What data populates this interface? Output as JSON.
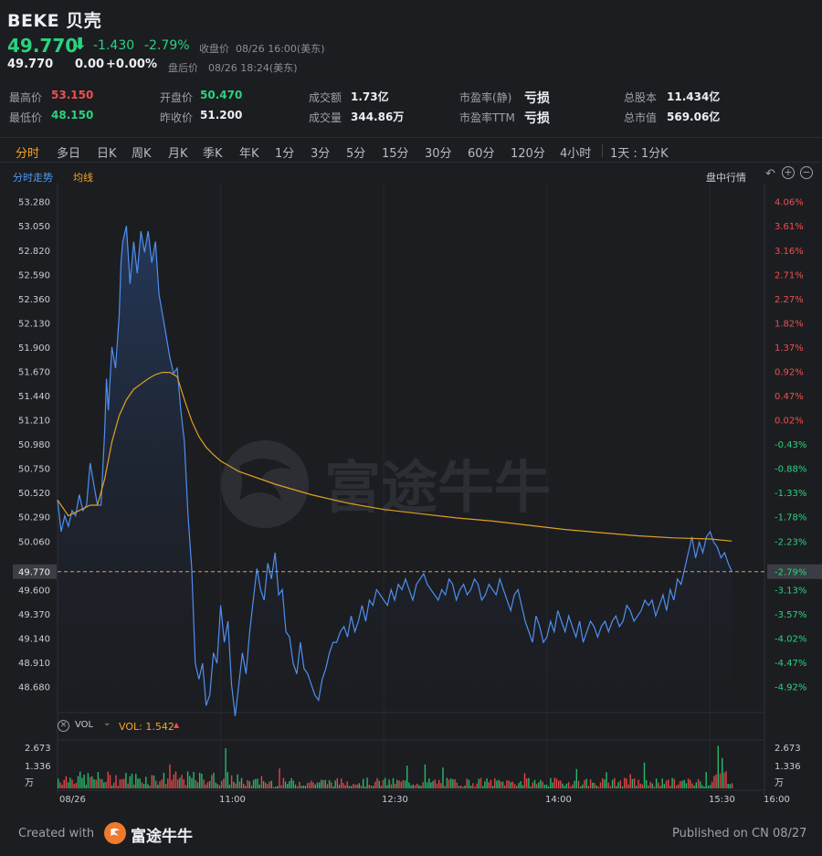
{
  "header": {
    "symbol_name": "BEKE 贝壳",
    "price": "49.770",
    "change": "-1.430",
    "change_pct": "-2.79%",
    "close_label": "收盘价",
    "close_time": "08/26 16:00(美东)",
    "after_price": "49.770",
    "after_change": "0.00",
    "after_pct": "+0.00%",
    "after_label": "盘后价",
    "after_time": "08/26 18:24(美东)"
  },
  "stats": [
    {
      "label": "最高价",
      "value": "53.150",
      "color": "#ee4f4f"
    },
    {
      "label": "开盘价",
      "value": "50.470",
      "color": "#2ad37e"
    },
    {
      "label": "成交额",
      "value": "1.73亿",
      "color": "#eceff3"
    },
    {
      "label": "市盈率(静)",
      "value": "亏损",
      "color": "#eceff3"
    },
    {
      "label": "总股本",
      "value": "11.434亿",
      "color": "#eceff3"
    },
    {
      "label": "最低价",
      "value": "48.150",
      "color": "#2ad37e"
    },
    {
      "label": "昨收价",
      "value": "51.200",
      "color": "#eceff3"
    },
    {
      "label": "成交量",
      "value": "344.86万",
      "color": "#eceff3"
    },
    {
      "label": "市盈率TTM",
      "value": "亏损",
      "color": "#eceff3"
    },
    {
      "label": "总市值",
      "value": "569.06亿",
      "color": "#eceff3"
    }
  ],
  "tabs": [
    "分时",
    "多日",
    "日K",
    "周K",
    "月K",
    "季K",
    "年K",
    "1分",
    "3分",
    "5分",
    "15分",
    "30分",
    "60分",
    "120分",
    "4小时",
    "1天 : 1分K"
  ],
  "active_tab": "分时",
  "chart_header": {
    "left_label": "分时走势",
    "avg_label": "均线",
    "right_label": "盘中行情"
  },
  "volume": {
    "vol_label": "VOL",
    "vol_value": "VOL: 1.542",
    "y_ticks": [
      "2.673",
      "1.336",
      "万"
    ]
  },
  "watermark": "富途牛牛",
  "footer": {
    "created_with": "Created with",
    "brand": "富途牛牛",
    "published": "Published on CN 08/27"
  },
  "chart_data": {
    "type": "line",
    "title": "",
    "prev_close": 51.2,
    "last_price": 49.77,
    "y_ticks": [
      53.28,
      53.05,
      52.82,
      52.59,
      52.36,
      52.13,
      51.9,
      51.67,
      51.44,
      51.21,
      50.98,
      50.75,
      50.52,
      50.29,
      50.06,
      49.77,
      49.6,
      49.37,
      49.14,
      48.91,
      48.68
    ],
    "y_tick_labels": [
      "53.280",
      "53.050",
      "52.820",
      "52.590",
      "52.360",
      "52.130",
      "51.900",
      "51.670",
      "51.440",
      "51.210",
      "50.980",
      "50.750",
      "50.520",
      "50.290",
      "50.060",
      "49.770",
      "49.600",
      "49.370",
      "49.140",
      "48.910",
      "48.680"
    ],
    "pct_labels": [
      "4.06%",
      "3.61%",
      "3.16%",
      "2.71%",
      "2.27%",
      "1.82%",
      "1.37%",
      "0.92%",
      "0.47%",
      "0.02%",
      "-0.43%",
      "-0.88%",
      "-1.33%",
      "-1.78%",
      "-2.23%",
      "-2.79%",
      "-3.13%",
      "-3.57%",
      "-4.02%",
      "-4.47%",
      "-4.92%"
    ],
    "x_labels": [
      "08/26",
      "11:00",
      "12:30",
      "14:00",
      "15:30",
      "16:00"
    ],
    "x_label_minutes": [
      0,
      90,
      180,
      270,
      360,
      390
    ],
    "price_points": [
      [
        0,
        50.45
      ],
      [
        2,
        50.15
      ],
      [
        4,
        50.3
      ],
      [
        6,
        50.2
      ],
      [
        8,
        50.35
      ],
      [
        10,
        50.3
      ],
      [
        12,
        50.5
      ],
      [
        14,
        50.35
      ],
      [
        16,
        50.4
      ],
      [
        18,
        50.8
      ],
      [
        20,
        50.6
      ],
      [
        22,
        50.4
      ],
      [
        24,
        50.4
      ],
      [
        26,
        51.1
      ],
      [
        27,
        51.6
      ],
      [
        28,
        51.3
      ],
      [
        30,
        51.9
      ],
      [
        32,
        51.7
      ],
      [
        34,
        52.2
      ],
      [
        35,
        52.7
      ],
      [
        36,
        52.9
      ],
      [
        38,
        53.05
      ],
      [
        40,
        52.5
      ],
      [
        42,
        52.9
      ],
      [
        44,
        52.6
      ],
      [
        46,
        53.0
      ],
      [
        48,
        52.8
      ],
      [
        50,
        53.0
      ],
      [
        52,
        52.7
      ],
      [
        54,
        52.9
      ],
      [
        56,
        52.4
      ],
      [
        58,
        52.2
      ],
      [
        60,
        52.0
      ],
      [
        62,
        51.8
      ],
      [
        64,
        51.65
      ],
      [
        66,
        51.7
      ],
      [
        68,
        51.3
      ],
      [
        70,
        51.0
      ],
      [
        72,
        50.3
      ],
      [
        74,
        49.8
      ],
      [
        76,
        48.9
      ],
      [
        78,
        48.75
      ],
      [
        80,
        48.9
      ],
      [
        82,
        48.5
      ],
      [
        84,
        48.6
      ],
      [
        86,
        49.0
      ],
      [
        88,
        48.9
      ],
      [
        90,
        49.45
      ],
      [
        92,
        49.1
      ],
      [
        94,
        49.3
      ],
      [
        96,
        48.7
      ],
      [
        98,
        48.4
      ],
      [
        100,
        48.7
      ],
      [
        102,
        49.0
      ],
      [
        104,
        48.8
      ],
      [
        106,
        49.2
      ],
      [
        108,
        49.5
      ],
      [
        110,
        49.8
      ],
      [
        112,
        49.6
      ],
      [
        114,
        49.5
      ],
      [
        116,
        49.85
      ],
      [
        118,
        49.7
      ],
      [
        120,
        49.95
      ],
      [
        122,
        49.55
      ],
      [
        124,
        49.6
      ],
      [
        126,
        49.2
      ],
      [
        128,
        49.15
      ],
      [
        130,
        48.9
      ],
      [
        132,
        48.8
      ],
      [
        134,
        49.1
      ],
      [
        136,
        48.85
      ],
      [
        138,
        48.8
      ],
      [
        140,
        48.7
      ],
      [
        142,
        48.6
      ],
      [
        144,
        48.55
      ],
      [
        146,
        48.75
      ],
      [
        148,
        48.85
      ],
      [
        150,
        49.0
      ],
      [
        152,
        49.1
      ],
      [
        154,
        49.1
      ],
      [
        156,
        49.2
      ],
      [
        158,
        49.25
      ],
      [
        160,
        49.15
      ],
      [
        162,
        49.35
      ],
      [
        164,
        49.2
      ],
      [
        166,
        49.3
      ],
      [
        168,
        49.45
      ],
      [
        170,
        49.3
      ],
      [
        172,
        49.5
      ],
      [
        174,
        49.45
      ],
      [
        176,
        49.6
      ],
      [
        178,
        49.55
      ],
      [
        180,
        49.5
      ],
      [
        182,
        49.45
      ],
      [
        184,
        49.6
      ],
      [
        186,
        49.5
      ],
      [
        188,
        49.65
      ],
      [
        190,
        49.6
      ],
      [
        192,
        49.7
      ],
      [
        194,
        49.6
      ],
      [
        196,
        49.5
      ],
      [
        198,
        49.65
      ],
      [
        200,
        49.7
      ],
      [
        202,
        49.75
      ],
      [
        204,
        49.65
      ],
      [
        206,
        49.6
      ],
      [
        208,
        49.55
      ],
      [
        210,
        49.5
      ],
      [
        212,
        49.6
      ],
      [
        214,
        49.55
      ],
      [
        216,
        49.7
      ],
      [
        218,
        49.65
      ],
      [
        220,
        49.5
      ],
      [
        222,
        49.6
      ],
      [
        224,
        49.65
      ],
      [
        226,
        49.55
      ],
      [
        228,
        49.6
      ],
      [
        230,
        49.7
      ],
      [
        232,
        49.65
      ],
      [
        234,
        49.5
      ],
      [
        236,
        49.55
      ],
      [
        238,
        49.65
      ],
      [
        240,
        49.6
      ],
      [
        242,
        49.55
      ],
      [
        244,
        49.7
      ],
      [
        246,
        49.6
      ],
      [
        248,
        49.5
      ],
      [
        250,
        49.4
      ],
      [
        252,
        49.55
      ],
      [
        254,
        49.6
      ],
      [
        256,
        49.45
      ],
      [
        258,
        49.3
      ],
      [
        260,
        49.2
      ],
      [
        262,
        49.1
      ],
      [
        264,
        49.35
      ],
      [
        266,
        49.25
      ],
      [
        268,
        49.1
      ],
      [
        270,
        49.15
      ],
      [
        272,
        49.3
      ],
      [
        274,
        49.2
      ],
      [
        276,
        49.4
      ],
      [
        278,
        49.3
      ],
      [
        280,
        49.2
      ],
      [
        282,
        49.35
      ],
      [
        284,
        49.25
      ],
      [
        286,
        49.15
      ],
      [
        288,
        49.3
      ],
      [
        290,
        49.1
      ],
      [
        292,
        49.2
      ],
      [
        294,
        49.3
      ],
      [
        296,
        49.25
      ],
      [
        298,
        49.15
      ],
      [
        300,
        49.25
      ],
      [
        302,
        49.3
      ],
      [
        304,
        49.2
      ],
      [
        306,
        49.3
      ],
      [
        308,
        49.35
      ],
      [
        310,
        49.25
      ],
      [
        312,
        49.3
      ],
      [
        314,
        49.45
      ],
      [
        316,
        49.4
      ],
      [
        318,
        49.3
      ],
      [
        320,
        49.35
      ],
      [
        322,
        49.4
      ],
      [
        324,
        49.5
      ],
      [
        326,
        49.45
      ],
      [
        328,
        49.5
      ],
      [
        330,
        49.35
      ],
      [
        332,
        49.45
      ],
      [
        334,
        49.55
      ],
      [
        336,
        49.4
      ],
      [
        338,
        49.6
      ],
      [
        340,
        49.5
      ],
      [
        342,
        49.7
      ],
      [
        344,
        49.65
      ],
      [
        346,
        49.8
      ],
      [
        348,
        49.95
      ],
      [
        350,
        50.1
      ],
      [
        352,
        49.9
      ],
      [
        354,
        50.05
      ],
      [
        356,
        49.95
      ],
      [
        358,
        50.1
      ],
      [
        360,
        50.15
      ],
      [
        362,
        50.05
      ],
      [
        364,
        50.0
      ],
      [
        366,
        49.9
      ],
      [
        368,
        49.95
      ],
      [
        370,
        49.85
      ],
      [
        372,
        49.77
      ]
    ],
    "avg_points": [
      [
        0,
        50.45
      ],
      [
        6,
        50.3
      ],
      [
        12,
        50.35
      ],
      [
        18,
        50.4
      ],
      [
        22,
        50.4
      ],
      [
        26,
        50.65
      ],
      [
        30,
        51.0
      ],
      [
        34,
        51.25
      ],
      [
        38,
        51.4
      ],
      [
        42,
        51.5
      ],
      [
        46,
        51.55
      ],
      [
        50,
        51.6
      ],
      [
        54,
        51.64
      ],
      [
        58,
        51.66
      ],
      [
        62,
        51.66
      ],
      [
        66,
        51.62
      ],
      [
        70,
        51.4
      ],
      [
        74,
        51.2
      ],
      [
        78,
        51.05
      ],
      [
        82,
        50.95
      ],
      [
        86,
        50.88
      ],
      [
        90,
        50.82
      ],
      [
        100,
        50.72
      ],
      [
        110,
        50.66
      ],
      [
        120,
        50.6
      ],
      [
        140,
        50.5
      ],
      [
        160,
        50.42
      ],
      [
        180,
        50.36
      ],
      [
        200,
        50.32
      ],
      [
        220,
        50.28
      ],
      [
        240,
        50.25
      ],
      [
        260,
        50.21
      ],
      [
        280,
        50.17
      ],
      [
        300,
        50.14
      ],
      [
        320,
        50.11
      ],
      [
        340,
        50.09
      ],
      [
        360,
        50.08
      ],
      [
        372,
        50.06
      ]
    ],
    "volume_max": 2.673,
    "volume_unit": "万"
  }
}
